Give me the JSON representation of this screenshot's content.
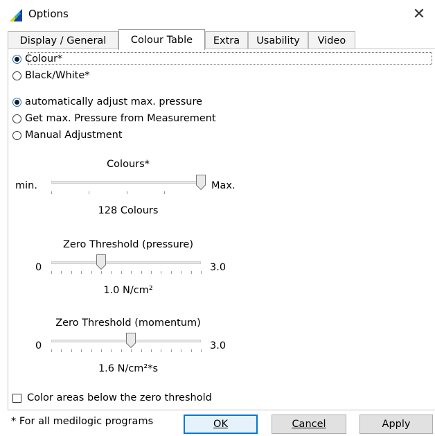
{
  "window": {
    "title": "Options",
    "close_symbol": "✕",
    "icon": "app-logo-icon"
  },
  "tabs": [
    {
      "label": "Display / General",
      "active": false
    },
    {
      "label": "Colour Table",
      "active": true
    },
    {
      "label": "Extra",
      "active": false
    },
    {
      "label": "Usability",
      "active": false
    },
    {
      "label": "Video",
      "active": false
    }
  ],
  "color_mode": {
    "options": [
      {
        "label": "Colour*",
        "checked": true
      },
      {
        "label": "Black/White*",
        "checked": false
      }
    ]
  },
  "pressure_mode": {
    "options": [
      {
        "label": "automatically adjust max. pressure",
        "checked": true
      },
      {
        "label": "Get max. Pressure from Measurement",
        "checked": false
      },
      {
        "label": "Manual Adjustment",
        "checked": false
      }
    ]
  },
  "colours_slider": {
    "title": "Colours*",
    "min_label": "min.",
    "max_label": "Max.",
    "value_text": "128 Colours",
    "position_fraction": 1.0
  },
  "pressure_slider": {
    "title": "Zero Threshold (pressure)",
    "min_label": "0",
    "max_label": "3.0",
    "value_text": "1.0 N/cm²",
    "value": 1.0,
    "min": 0,
    "max": 3.0
  },
  "momentum_slider": {
    "title": "Zero Threshold (momentum)",
    "min_label": "0",
    "max_label": "3.0",
    "value_text": "1.6 N/cm²*s",
    "value": 1.6,
    "min": 0,
    "max": 3.0
  },
  "color_below_zero": {
    "label": "Color areas below the zero threshold",
    "checked": false
  },
  "footer": {
    "note": "* For all medilogic programs",
    "ok_label": "OK",
    "cancel_label": "Cancel",
    "apply_label": "Apply"
  },
  "colors": {
    "accent": "#0078d7",
    "button_face": "#e1e1e1"
  }
}
